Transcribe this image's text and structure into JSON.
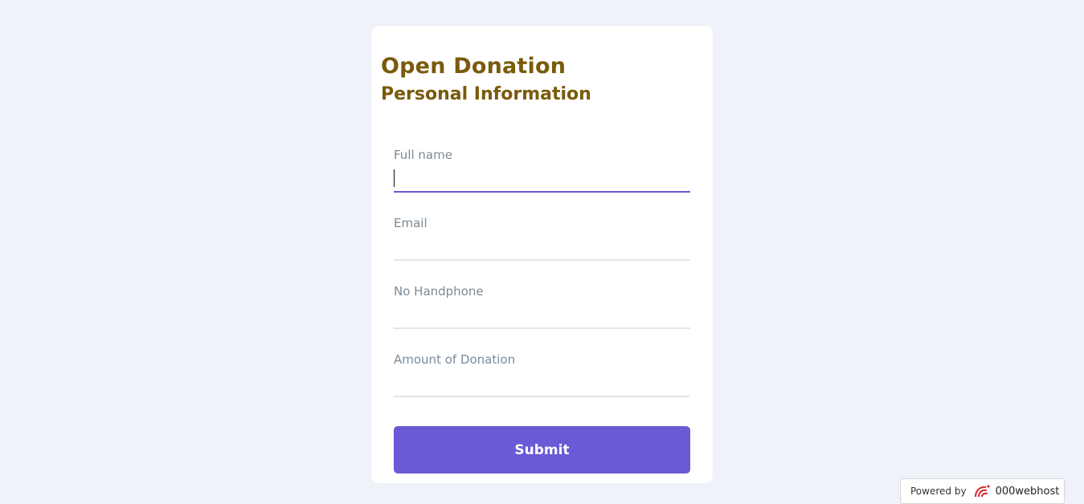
{
  "form": {
    "title": "Open Donation",
    "subtitle": "Personal Information",
    "fields": [
      {
        "label": "Full name",
        "value": ""
      },
      {
        "label": "Email",
        "value": ""
      },
      {
        "label": "No Handphone",
        "value": ""
      },
      {
        "label": "Amount of Donation",
        "value": ""
      }
    ],
    "submit_label": "Submit"
  },
  "footer": {
    "powered_by": "Powered by",
    "brand": "000webhost",
    "logo_icon": "000webhost-logo-icon"
  },
  "colors": {
    "heading": "#7a5a0c",
    "accent": "#6a5ad6",
    "background": "#eff2f9"
  }
}
